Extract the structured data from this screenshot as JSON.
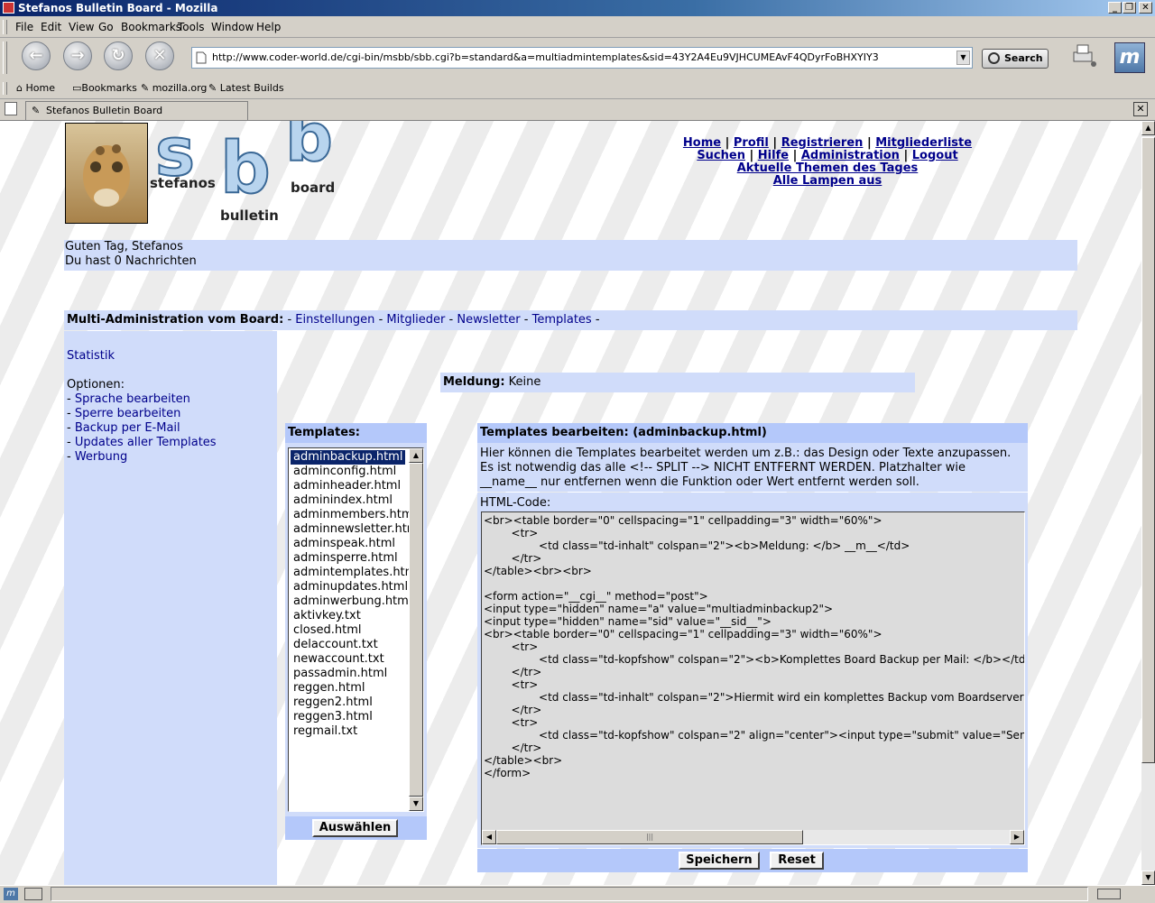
{
  "window": {
    "title": "Stefanos Bulletin Board - Mozilla"
  },
  "menubar": {
    "items": [
      "File",
      "Edit",
      "View",
      "Go",
      "Bookmarks",
      "Tools",
      "Window",
      "Help"
    ]
  },
  "navbar": {
    "url": "http://www.coder-world.de/cgi-bin/msbb/sbb.cgi?b=standard&a=multiadmintemplates&sid=43Y2A4Eu9VJHCUMEAvF4QDyrFoBHXYIY3",
    "search_label": "Search"
  },
  "bookmarks": {
    "items": [
      "Home",
      "Bookmarks",
      "mozilla.org",
      "Latest Builds"
    ]
  },
  "tab": {
    "label": "Stefanos Bulletin Board"
  },
  "header": {
    "logo_word1": "stefanos",
    "logo_word2": "bulletin",
    "logo_word3": "board",
    "links_row1": [
      "Home",
      "Profil",
      "Registrieren",
      "Mitgliederliste"
    ],
    "links_row2": [
      "Suchen",
      "Hilfe",
      "Administration",
      "Logout"
    ],
    "links_row3": "Aktuelle Themen des Tages",
    "links_row4": "Alle Lampen aus"
  },
  "greeting": {
    "line1": "Guten Tag, Stefanos",
    "line2": "Du hast 0 Nachrichten"
  },
  "admin_bar": {
    "label": "Multi-Administration vom Board:",
    "links": [
      "Einstellungen",
      "Mitglieder",
      "Newsletter",
      "Templates"
    ]
  },
  "sidebar": {
    "statistik": "Statistik",
    "optionen_label": "Optionen:",
    "options": [
      "Sprache bearbeiten",
      "Sperre bearbeiten",
      "Backup per E-Mail",
      "Updates aller Templates",
      "Werbung"
    ]
  },
  "meldung": {
    "label": "Meldung:",
    "value": "Keine"
  },
  "templates_panel": {
    "title": "Templates:",
    "selected_index": 0,
    "items": [
      "adminbackup.html",
      "adminconfig.html",
      "adminheader.html",
      "adminindex.html",
      "adminmembers.html",
      "adminnewsletter.html",
      "adminspeak.html",
      "adminsperre.html",
      "admintemplates.html",
      "adminupdates.html",
      "adminwerbung.html",
      "aktivkey.txt",
      "closed.html",
      "delaccount.txt",
      "newaccount.txt",
      "passadmin.html",
      "reggen.html",
      "reggen2.html",
      "reggen3.html",
      "regmail.txt"
    ],
    "select_button": "Auswählen"
  },
  "editor": {
    "title": "Templates bearbeiten: (adminbackup.html)",
    "desc1": "Hier können die Templates bearbeitet werden um z.B.: das Design oder Texte anzupassen.",
    "desc2": "Es ist notwendig das alle <!-- SPLIT --> NICHT ENTFERNT WERDEN. Platzhalter wie",
    "desc3": "__name__ nur entfernen wenn die Funktion oder Wert entfernt werden soll.",
    "code_label": "HTML-Code:",
    "code": "<br><table border=\"0\" cellspacing=\"1\" cellpadding=\"3\" width=\"60%\">\n        <tr>\n                <td class=\"td-inhalt\" colspan=\"2\"><b>Meldung: </b> __m__</td>\n        </tr>\n</table><br><br>\n\n<form action=\"__cgi__\" method=\"post\">\n<input type=\"hidden\" name=\"a\" value=\"multiadminbackup2\">\n<input type=\"hidden\" name=\"sid\" value=\"__sid__\">\n<br><table border=\"0\" cellspacing=\"1\" cellpadding=\"3\" width=\"60%\">\n        <tr>\n                <td class=\"td-kopfshow\" colspan=\"2\"><b>Komplettes Board Backup per Mail: </b></td>\n        </tr>\n        <tr>\n                <td class=\"td-inhalt\" colspan=\"2\">Hiermit wird ein komplettes Backup vom Boardserver erstellt</td>\n        </tr>\n        <tr>\n                <td class=\"td-kopfshow\" colspan=\"2\" align=\"center\"><input type=\"submit\" value=\"Senden\"></td>\n        </tr>\n</table><br>\n</form>",
    "save_button": "Speichern",
    "reset_button": "Reset"
  }
}
